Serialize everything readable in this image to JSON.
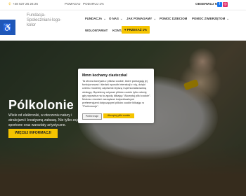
{
  "topbar": {
    "phone": "+48 537 26 26 26",
    "pomagaj": "POMAGAJ",
    "podaruj": "PODARUJ 1%",
    "obserwuj": "OBSERWUJ NAS"
  },
  "logo": {
    "alt": "Fundacja-Spoleczniani-logo-kolor"
  },
  "nav": {
    "fundacja": "FUNDACJA",
    "o_nas": "O NAS",
    "jak_pomagamy": "JAK POMAGAMY",
    "pomoc_dzieciom": "POMOC DZIECIOM",
    "pomoc_zwierzetom": "POMOC ZWIERZĘTOM",
    "wolontariat": "WOLONTARIAT",
    "kontakt": "KONTAKT",
    "donate": "PRZEKAŻ 1%"
  },
  "hero": {
    "title": "Pólkolonie",
    "text": "Wiele od elektroniki, w otoczeniu natury i atrakcjami i kreatywną zabawą. Nie tylko zajęcia sportowe oraz warsztaty artystyczne.",
    "button": "WIĘCEJ INFORMACJI"
  },
  "cookie": {
    "title": "Mmm kochamy ciasteczka!",
    "text": "Ta strona korzysta z plików cookie, które pomagają jej funkcjonować i śledzić sposób interakcji z nią, dzięki czemu możemy zapewnić lepszą i spersonalizowaną obsługę. Będziemy używać plików cookie tylko wtedy, gdy wyrazisz na to zgodę klikając \"Akceptuj pliki cookie\". Możesz również zarządzać indywidualnymi preferencjami dotyczącymi plików cookie klikając w \"Preferencje\".",
    "preferences": "Preferencje",
    "accept": "Akceptuj pliki cookie"
  },
  "colors": {
    "accent": "#f5c400",
    "accessibility": "#1f57b8"
  }
}
